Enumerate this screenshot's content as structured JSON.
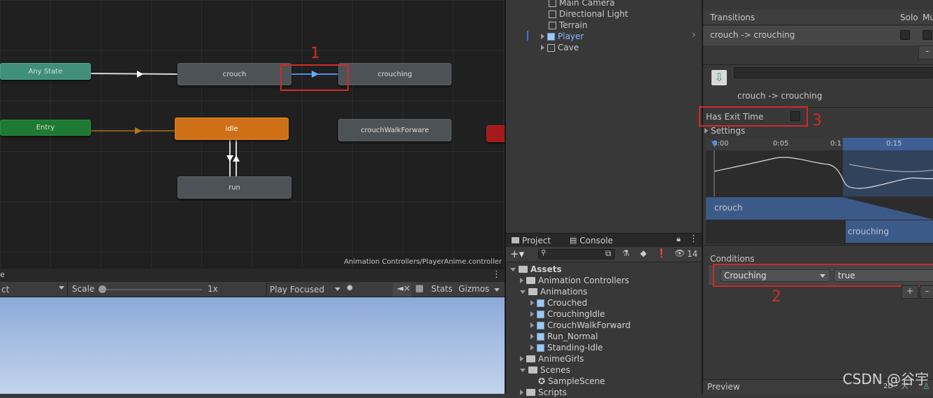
{
  "animator": {
    "path": "Animation Controllers/PlayerAnime.controller",
    "states": {
      "any_state": "Any State",
      "entry": "Entry",
      "crouch": "crouch",
      "crouching": "crouching",
      "idle": "idle",
      "crouch_walk": "crouchWalkForware",
      "run": "run"
    },
    "annotation_1": "1"
  },
  "scene_toolbar": {
    "first_dropdown": "ct",
    "scale_label": "Scale",
    "scale_value": "1x",
    "play_focused": "Play Focused",
    "stats": "Stats",
    "gizmos": "Gizmos"
  },
  "hierarchy": {
    "items": [
      "Main Camera",
      "Directional Light",
      "Terrain",
      "Player",
      "Cave"
    ]
  },
  "project": {
    "tab_project": "Project",
    "tab_console": "Console",
    "hidden_count": "14",
    "tree": [
      "Assets",
      "Animation Controllers",
      "Animations",
      "Crouched",
      "CrouchingIdle",
      "CrouchWalkForward",
      "Run_Normal",
      "Standing-Idle",
      "AnimeGirls",
      "Scenes",
      "SampleScene",
      "Scripts"
    ]
  },
  "inspector": {
    "transitions_label": "Transitions",
    "solo_label": "Solo",
    "mute_label": "Mu",
    "transition_item": "crouch -> crouching",
    "transition_title": "crouch -> crouching",
    "has_exit_time": "Has Exit Time",
    "annotation_3": "3",
    "settings": "Settings",
    "timeline_ticks": [
      "0:00",
      "0:05",
      "0:1",
      "0:15"
    ],
    "clip_from": "crouch",
    "clip_to": "crouching",
    "conditions_label": "Conditions",
    "condition_param": "Crouching",
    "condition_value": "true",
    "annotation_2": "2",
    "preview": "Preview",
    "mode_2d": "2D",
    "watermark": "CSDN @谷宇"
  }
}
